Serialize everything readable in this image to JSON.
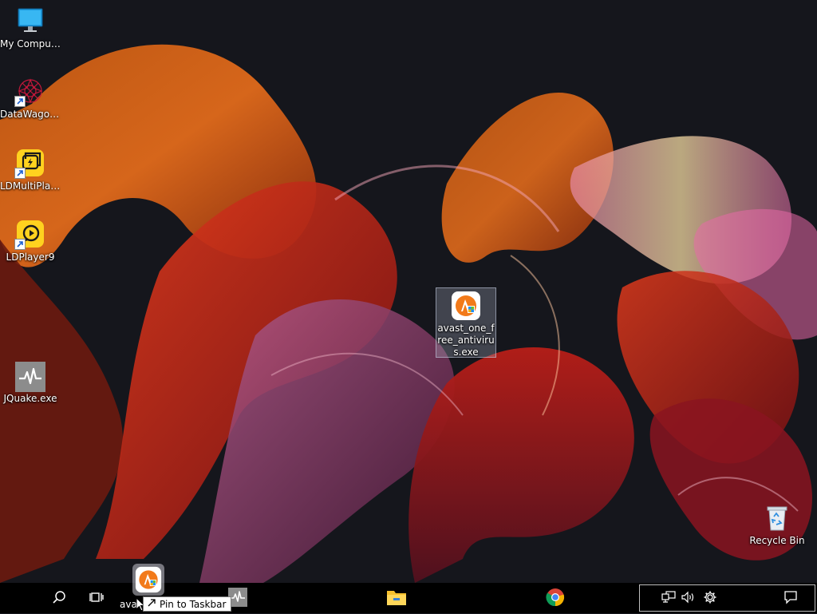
{
  "desktop": {
    "icons": [
      {
        "label": "My Computer",
        "icon": "monitor-icon"
      },
      {
        "label": "DataWagon...",
        "icon": "datawagon-icon"
      },
      {
        "label": "LDMultiPlay...",
        "icon": "ldmultiplayer-icon"
      },
      {
        "label": "LDPlayer9",
        "icon": "ldplayer-icon"
      },
      {
        "label": "JQuake.exe",
        "icon": "jquake-icon"
      },
      {
        "label": "avast_one_free_antivirus.exe",
        "icon": "avast-icon"
      },
      {
        "label": "Recycle Bin",
        "icon": "recycle-bin-icon"
      }
    ]
  },
  "drag": {
    "label": "ava",
    "tooltip": "Pin to Taskbar"
  },
  "taskbar": {
    "buttons": [
      "search-icon",
      "task-view-icon",
      "jquake-icon",
      "file-explorer-icon",
      "chrome-icon"
    ],
    "tray": [
      "network-icon",
      "volume-icon",
      "settings-icon",
      "notification-icon"
    ]
  },
  "colors": {
    "taskbar": "#000000",
    "desktop_bg": "#15161c",
    "ldplayer_yellow": "#ffd21f",
    "avast_orange": "#f27a1a"
  }
}
